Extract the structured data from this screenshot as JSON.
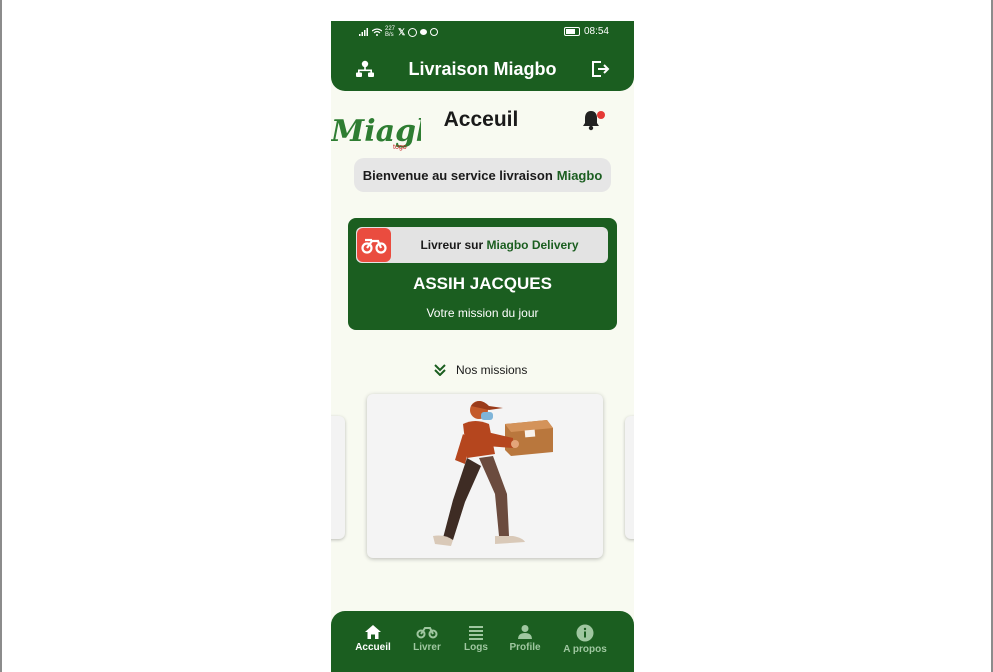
{
  "status": {
    "net_speed": "227\nB/s",
    "time": "08:54"
  },
  "appbar": {
    "title": "Livraison Miagbo"
  },
  "logo": {
    "text": "Miagbo",
    "subtext": "togo"
  },
  "page": {
    "title": "Acceuil"
  },
  "welcome": {
    "text": "Bienvenue au service livraison",
    "brand": "Miagbo"
  },
  "driver_card": {
    "chip_prefix": "Livreur sur",
    "chip_brand": "Miagbo Delivery",
    "name": "ASSIH JACQUES",
    "subtitle": "Votre mission du jour"
  },
  "missions": {
    "label": "Nos missions"
  },
  "bottom_nav": {
    "items": [
      {
        "label": "Accueil",
        "icon": "home-icon",
        "active": true
      },
      {
        "label": "Livrer",
        "icon": "scooter-icon",
        "active": false
      },
      {
        "label": "Logs",
        "icon": "list-icon",
        "active": false
      },
      {
        "label": "Profile",
        "icon": "person-icon",
        "active": false
      },
      {
        "label": "A propos",
        "icon": "info-icon",
        "active": false
      }
    ]
  },
  "colors": {
    "primary": "#1b5e20",
    "accent": "#ea4c3f",
    "background": "#f8faf1"
  }
}
